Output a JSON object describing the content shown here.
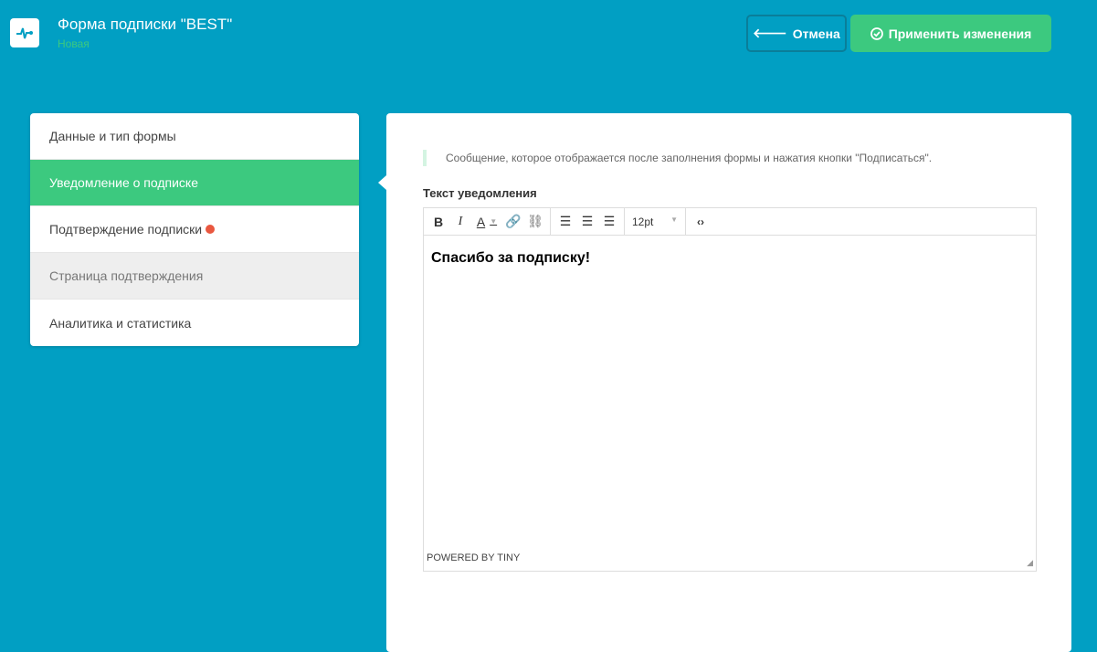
{
  "header": {
    "title": "Форма подписки \"BEST\"",
    "status": "Новая",
    "cancel_label": "Отмена",
    "apply_label": "Применить изменения"
  },
  "sidebar": {
    "items": [
      {
        "label": "Данные и тип формы"
      },
      {
        "label": "Уведомление о подписке"
      },
      {
        "label": "Подтверждение подписки"
      },
      {
        "label": "Страница подтверждения"
      },
      {
        "label": "Аналитика и статистика"
      }
    ]
  },
  "main": {
    "note": "Сообщение, которое отображается после заполнения формы и нажатия кнопки \"Подписаться\".",
    "field_label": "Текст уведомления",
    "editor": {
      "font_size": "12pt",
      "content": "Спасибо за подписку!",
      "powered": "POWERED BY TINY"
    }
  },
  "colors": {
    "background": "#019fc3",
    "accent": "#3cc97f",
    "alert": "#e9573f"
  }
}
